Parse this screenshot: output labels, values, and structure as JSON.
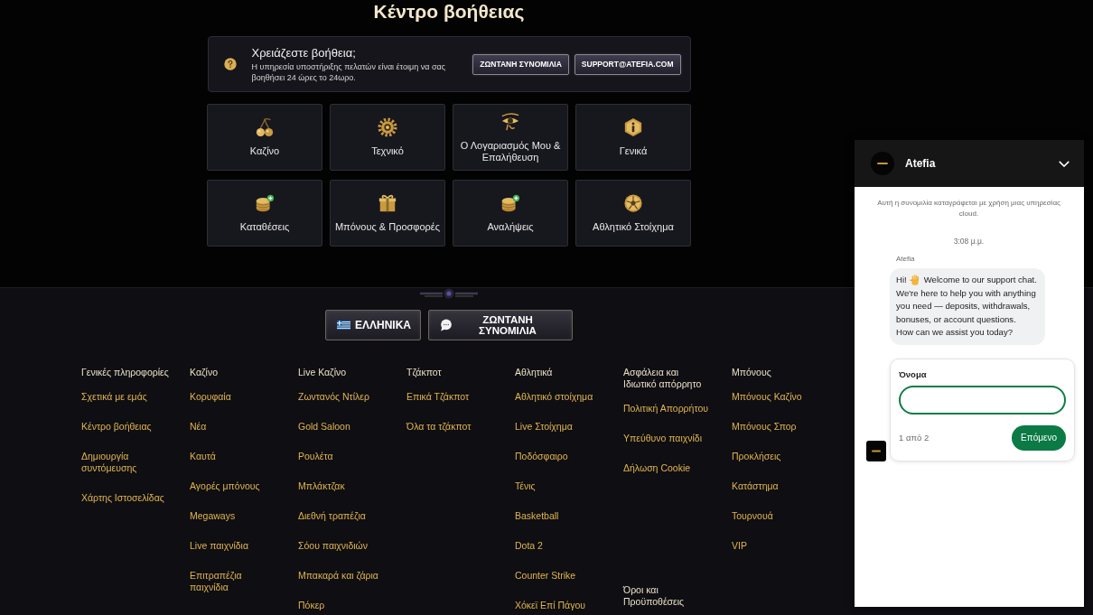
{
  "help_center": {
    "title": "Κέντρο βοήθειας",
    "contact_box": {
      "heading": "Χρειάζεστε βοήθεια;",
      "text": "Η υπηρεσία υποστήριξης πελατών είναι έτοιμη να σας βοηθήσει 24 ώρες το 24ωρο.",
      "buttons": [
        "ΖΩΝΤΑΝΗ ΣΥΝΟΜΙΛΙΑ",
        "SUPPORT@ATEFIA.COM"
      ]
    },
    "categories": [
      "Καζίνο",
      "Τεχνικό",
      "Ο Λογαριασμός Μου & Επαλήθευση",
      "Γενικά",
      "Καταθέσεις",
      "Μπόνους & Προσφορές",
      "Αναλήψεις",
      "Αθλητικό Στοίχημα"
    ]
  },
  "footer": {
    "buttons": [
      {
        "label": "ΕΛΛΗΝΙΚΑ",
        "kind": "language"
      },
      {
        "label": "ΖΩΝΤΑΝΗ ΣΥΝΟΜΙΛΙΑ",
        "kind": "chat"
      }
    ],
    "columns": [
      {
        "sections": [
          {
            "heading": "Γενικές πληροφορίες",
            "links": [
              "Σχετικά με εμάς",
              "Κέντρο βοήθειας",
              "Δημιουργία συντόμευσης",
              "Χάρτης Ιστοσελίδας"
            ]
          }
        ]
      },
      {
        "sections": [
          {
            "heading": "Καζίνο",
            "links": [
              "Κορυφαία",
              "Νέα",
              "Καυτά",
              "Αγορές μπόνους",
              "Megaways",
              "Live παιχνίδια",
              "Επιτραπέζια παιχνίδια"
            ]
          }
        ]
      },
      {
        "sections": [
          {
            "heading": "Live Καζίνο",
            "links": [
              "Ζωντανός Ντίλερ",
              "Gold Saloon",
              "Ρουλέτα",
              "Μπλάκτζακ",
              "Διεθνή τραπέζια",
              "Σόου παιχνιδιών",
              "Μπακαρά και ζάρια",
              "Πόκερ"
            ]
          }
        ]
      },
      {
        "sections": [
          {
            "heading": "Τζάκποτ",
            "links": [
              "Επικά Τζάκποτ",
              "Όλα τα τζάκποτ"
            ]
          }
        ]
      },
      {
        "sections": [
          {
            "heading": "Αθλητικά",
            "links": [
              "Αθλητικό στοίχημα",
              "Live Στοίχημα",
              "Ποδόσφαιρο",
              "Τένις",
              "Basketball",
              "Dota 2",
              "Counter Strike",
              "Χόκεϊ Επί Πάγου"
            ]
          }
        ]
      },
      {
        "sections": [
          {
            "heading": "Ασφάλεια και Ιδιωτικό απόρρητο",
            "links": [
              "Πολιτική Απορρήτου",
              "Υπεύθυνο παιχνίδι",
              "Δήλωση Cookie"
            ]
          },
          {
            "heading": "Όροι και Προϋποθέσεις"
          }
        ]
      },
      {
        "sections": [
          {
            "heading": "Μπόνους",
            "links": [
              "Μπόνους Καζίνο",
              "Μπόνους Σπορ",
              "Προκλήσεις",
              "Κατάστημα",
              "Τουρνουά",
              "VIP"
            ]
          }
        ]
      }
    ]
  },
  "chat_widget": {
    "title": "Atefia",
    "notice": "Αυτή η συνομιλία καταγράφεται με χρήση μιας υπηρεσίας cloud.",
    "time": "3:08 μ.μ.",
    "sender": "Atefia",
    "message": {
      "greeting": "Hi!",
      "first_line": "Welcome to our support chat.",
      "paragraphs": [
        "We're here to help you with anything you need — deposits, withdrawals, bonuses, or account questions.",
        "How can we assist you today?"
      ]
    },
    "form": {
      "label": "Όνομα",
      "step": "1 από 2",
      "button": "Επόμενο"
    }
  }
}
